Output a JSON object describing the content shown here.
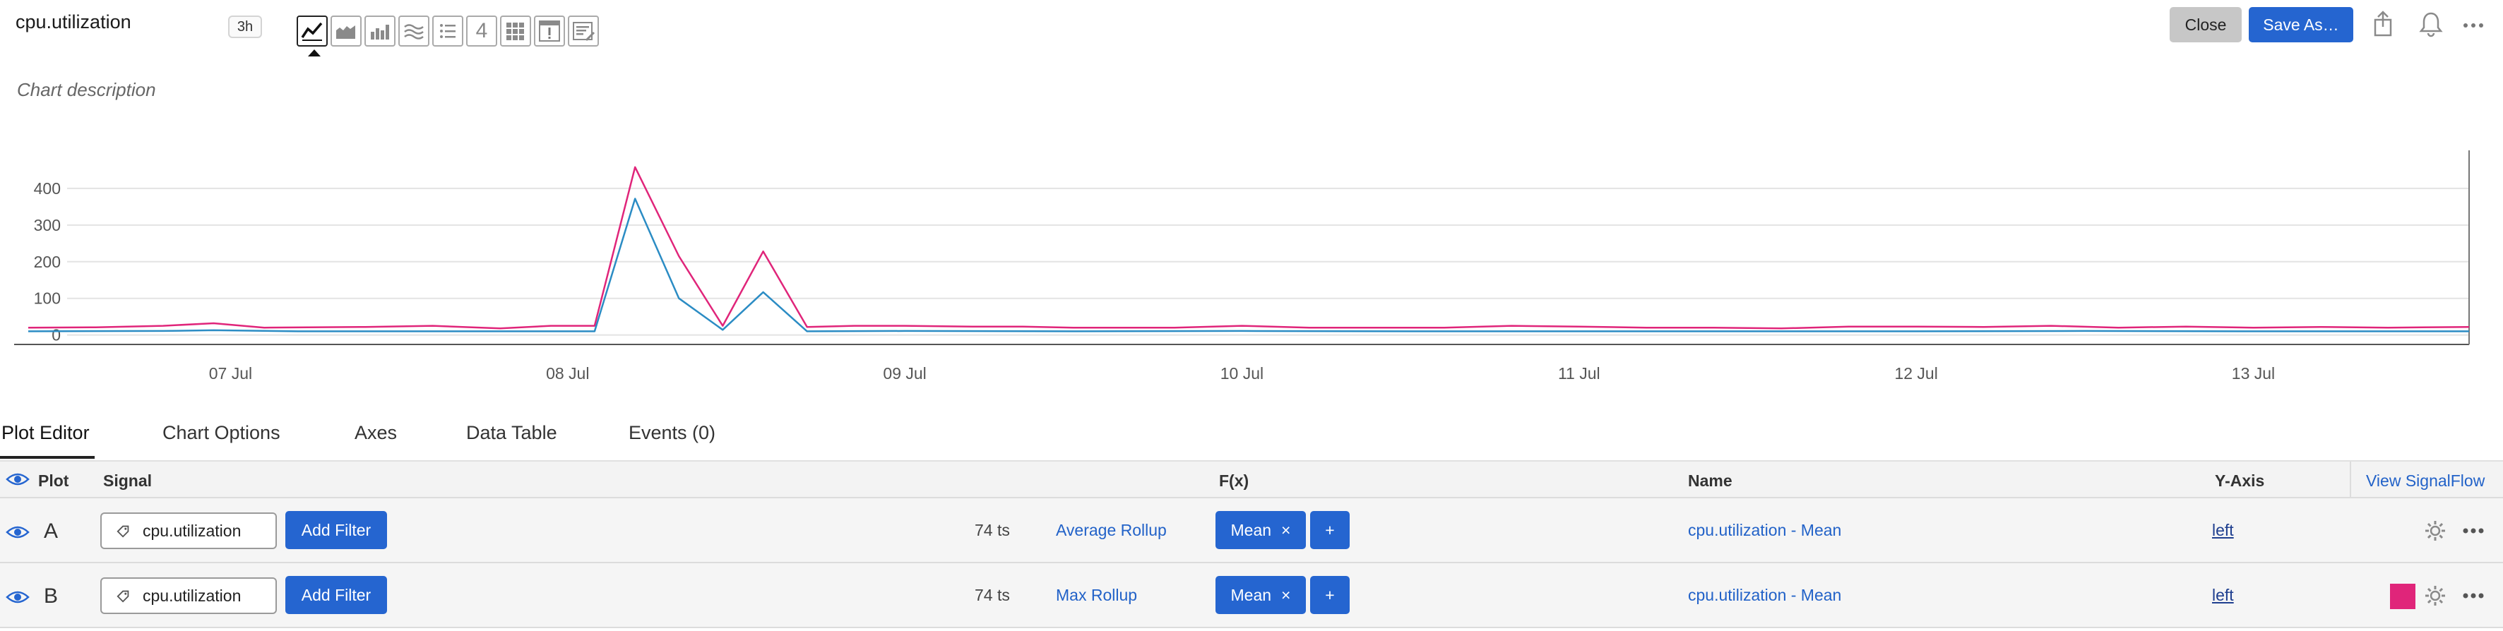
{
  "header": {
    "title": "cpu.utilization",
    "time_range": "3h",
    "chart_types": [
      "line-chart-icon",
      "area-chart-icon",
      "column-chart-icon",
      "heatmap-icon",
      "list-icon",
      "single-value-icon",
      "table-icon",
      "event-feed-icon",
      "text-note-icon"
    ],
    "single_value_label": "4",
    "close_label": "Close",
    "save_label": "Save As…"
  },
  "description": "Chart description",
  "chart_data": {
    "type": "line",
    "x_tick_labels": [
      "07 Jul",
      "08 Jul",
      "09 Jul",
      "10 Jul",
      "11 Jul",
      "12 Jul",
      "13 Jul"
    ],
    "y_tick_labels": [
      "0",
      "100",
      "200",
      "300",
      "400"
    ],
    "ylim": [
      -20,
      500
    ],
    "grid": true,
    "x_range_days": [
      6.4,
      13.64
    ],
    "series": [
      {
        "color": "#e0257a",
        "points": [
          [
            6.4,
            20
          ],
          [
            6.6,
            21
          ],
          [
            6.8,
            25
          ],
          [
            6.95,
            32
          ],
          [
            7.1,
            20
          ],
          [
            7.4,
            22
          ],
          [
            7.6,
            25
          ],
          [
            7.8,
            18
          ],
          [
            7.95,
            25
          ],
          [
            8.08,
            25
          ],
          [
            8.2,
            458
          ],
          [
            8.33,
            215
          ],
          [
            8.46,
            25
          ],
          [
            8.58,
            228
          ],
          [
            8.71,
            22
          ],
          [
            8.85,
            25
          ],
          [
            9.0,
            25
          ],
          [
            9.2,
            23
          ],
          [
            9.35,
            23
          ],
          [
            9.5,
            20
          ],
          [
            9.8,
            20
          ],
          [
            10.0,
            25
          ],
          [
            10.2,
            20
          ],
          [
            10.4,
            20
          ],
          [
            10.6,
            20
          ],
          [
            10.8,
            25
          ],
          [
            11.0,
            23
          ],
          [
            11.2,
            20
          ],
          [
            11.4,
            20
          ],
          [
            11.6,
            18
          ],
          [
            11.8,
            23
          ],
          [
            12.0,
            23
          ],
          [
            12.2,
            22
          ],
          [
            12.4,
            25
          ],
          [
            12.6,
            20
          ],
          [
            12.8,
            23
          ],
          [
            13.0,
            20
          ],
          [
            13.2,
            22
          ],
          [
            13.4,
            20
          ],
          [
            13.64,
            22
          ]
        ]
      },
      {
        "color": "#2b8cc4",
        "points": [
          [
            6.4,
            10
          ],
          [
            6.8,
            11
          ],
          [
            6.95,
            13
          ],
          [
            7.2,
            10
          ],
          [
            7.6,
            10
          ],
          [
            7.95,
            10
          ],
          [
            8.08,
            10
          ],
          [
            8.2,
            372
          ],
          [
            8.33,
            100
          ],
          [
            8.46,
            14
          ],
          [
            8.58,
            117
          ],
          [
            8.71,
            10
          ],
          [
            9.0,
            11
          ],
          [
            9.5,
            10
          ],
          [
            10.0,
            11
          ],
          [
            10.5,
            10
          ],
          [
            11.0,
            10
          ],
          [
            11.5,
            10
          ],
          [
            12.0,
            10
          ],
          [
            12.5,
            11
          ],
          [
            13.0,
            10
          ],
          [
            13.64,
            10
          ]
        ]
      }
    ]
  },
  "tabs": [
    "Plot Editor",
    "Chart Options",
    "Axes",
    "Data Table",
    "Events (0)"
  ],
  "table": {
    "headers": {
      "plot": "Plot",
      "signal": "Signal",
      "fx": "F(x)",
      "name": "Name",
      "y_axis": "Y-Axis",
      "view_signalflow": "View SignalFlow"
    },
    "rows": [
      {
        "letter": "A",
        "signal": "cpu.utilization",
        "add_filter": "Add Filter",
        "ts_count": "74 ts",
        "rollup": "Average Rollup",
        "fx": "Mean",
        "fx_close": "×",
        "fx_add": "+",
        "name": "cpu.utilization - Mean",
        "y_axis": "left",
        "swatch_color": ""
      },
      {
        "letter": "B",
        "signal": "cpu.utilization",
        "add_filter": "Add Filter",
        "ts_count": "74 ts",
        "rollup": "Max Rollup",
        "fx": "Mean",
        "fx_close": "×",
        "fx_add": "+",
        "name": "cpu.utilization - Mean",
        "y_axis": "left",
        "swatch_color": "#e0257a"
      }
    ]
  }
}
